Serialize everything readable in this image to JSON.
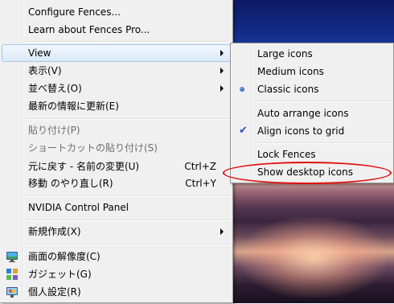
{
  "main_menu": {
    "items": [
      {
        "label": "Configure Fences..."
      },
      {
        "label": "Learn about Fences Pro..."
      },
      {
        "label": "View"
      },
      {
        "label": "表示(V)"
      },
      {
        "label": "並べ替え(O)"
      },
      {
        "label": "最新の情報に更新(E)"
      },
      {
        "label": "貼り付け(P)"
      },
      {
        "label": "ショートカットの貼り付け(S)"
      },
      {
        "label": "元に戻す - 名前の変更(U)",
        "shortcut": "Ctrl+Z"
      },
      {
        "label": "移動 のやり直し(R)",
        "shortcut": "Ctrl+Y"
      },
      {
        "label": "NVIDIA Control Panel"
      },
      {
        "label": "新規作成(X)"
      },
      {
        "label": "画面の解像度(C)",
        "icon": "monitor-icon"
      },
      {
        "label": "ガジェット(G)",
        "icon": "gadget-icon"
      },
      {
        "label": "個人設定(R)",
        "icon": "personalize-icon"
      }
    ]
  },
  "view_submenu": {
    "items": [
      {
        "label": "Large icons"
      },
      {
        "label": "Medium icons"
      },
      {
        "label": "Classic icons",
        "state": "selected-radio"
      },
      {
        "label": "Auto arrange icons"
      },
      {
        "label": "Align icons to grid",
        "state": "checked"
      },
      {
        "label": "Lock Fences"
      },
      {
        "label": "Show desktop icons"
      }
    ]
  },
  "colors": {
    "menu_bg": "#f0f0f0",
    "highlight_border": "#a8c7ef",
    "annotation_red": "#e01010",
    "disabled_text": "#6d6d6d"
  }
}
